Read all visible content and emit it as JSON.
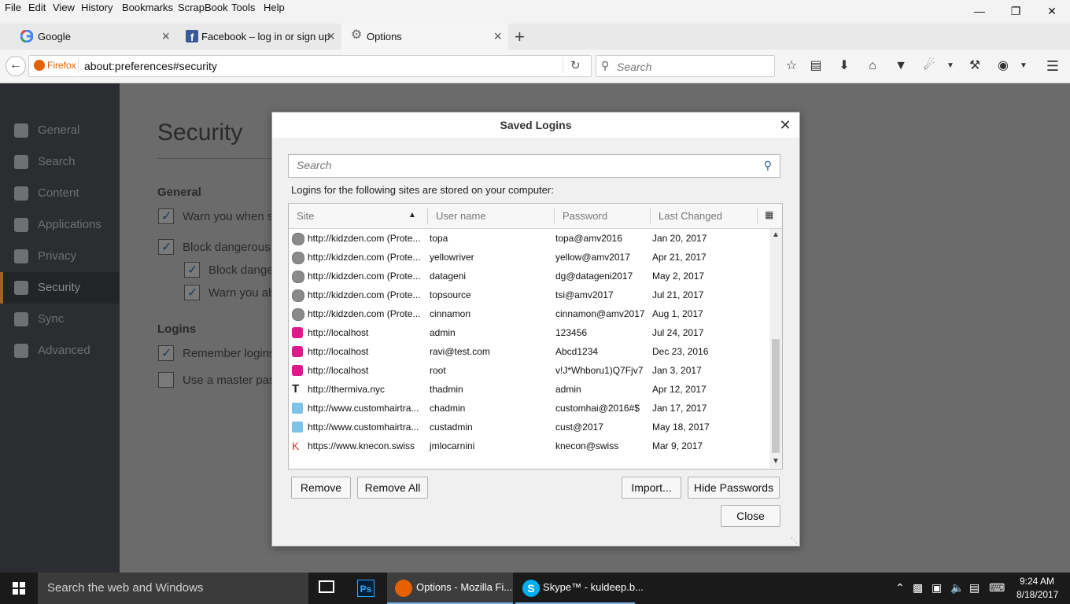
{
  "menubar": {
    "items": [
      "File",
      "Edit",
      "View",
      "History",
      "Bookmarks",
      "ScrapBook",
      "Tools",
      "Help"
    ]
  },
  "tabs": [
    {
      "title": "Google",
      "icon": "google-icon"
    },
    {
      "title": "Facebook – log in or sign up",
      "icon": "facebook-icon"
    },
    {
      "title": "Options",
      "icon": "gear-icon"
    }
  ],
  "navbar": {
    "identity_label": "Firefox",
    "url": "about:preferences#security",
    "search_placeholder": "Search"
  },
  "prefs": {
    "sidebar": [
      "General",
      "Search",
      "Content",
      "Applications",
      "Privacy",
      "Security",
      "Sync",
      "Advanced"
    ],
    "selected": "Security",
    "page_title": "Security",
    "general_heading": "General",
    "opt_warn": "Warn you when s",
    "opt_block": "Block dangerous",
    "opt_block_sub": "Block dange",
    "opt_warn_sub": "Warn you ab",
    "logins_heading": "Logins",
    "opt_remember": "Remember logins",
    "opt_master": "Use a master pas"
  },
  "dialog": {
    "title": "Saved Logins",
    "search_placeholder": "Search",
    "description": "Logins for the following sites are stored on your computer:",
    "columns": {
      "site": "Site",
      "username": "User name",
      "password": "Password",
      "changed": "Last Changed"
    },
    "rows": [
      {
        "site": "http://kidzden.com (Prote...",
        "user": "topa",
        "pass": "topa@amv2016",
        "changed": "Jan 20, 2017",
        "fav": "globe"
      },
      {
        "site": "http://kidzden.com (Prote...",
        "user": "yellowriver",
        "pass": "yellow@amv2017",
        "changed": "Apr 21, 2017",
        "fav": "globe"
      },
      {
        "site": "http://kidzden.com (Prote...",
        "user": "datageni",
        "pass": "dg@datageni2017",
        "changed": "May 2, 2017",
        "fav": "globe"
      },
      {
        "site": "http://kidzden.com (Prote...",
        "user": "topsource",
        "pass": "tsi@amv2017",
        "changed": "Jul 21, 2017",
        "fav": "globe"
      },
      {
        "site": "http://kidzden.com (Prote...",
        "user": "cinnamon",
        "pass": "cinnamon@amv2017",
        "changed": "Aug 1, 2017",
        "fav": "globe"
      },
      {
        "site": "http://localhost",
        "user": "admin",
        "pass": "123456",
        "changed": "Jul 24, 2017",
        "fav": "pink"
      },
      {
        "site": "http://localhost",
        "user": "ravi@test.com",
        "pass": "Abcd1234",
        "changed": "Dec 23, 2016",
        "fav": "pink"
      },
      {
        "site": "http://localhost",
        "user": "root",
        "pass": "v!J*Whboru1)Q7Fjv7",
        "changed": "Jan 3, 2017",
        "fav": "pink"
      },
      {
        "site": "http://thermiva.nyc",
        "user": "thadmin",
        "pass": "admin",
        "changed": "Apr 12, 2017",
        "fav": "T"
      },
      {
        "site": "http://www.customhairtra...",
        "user": "chadmin",
        "pass": "customhai@2016#$",
        "changed": "Jan 17, 2017",
        "fav": "blue"
      },
      {
        "site": "http://www.customhairtra...",
        "user": "custadmin",
        "pass": "cust@2017",
        "changed": "May 18, 2017",
        "fav": "blue"
      },
      {
        "site": "https://www.knecon.swiss",
        "user": "jmlocarnini",
        "pass": "knecon@swiss",
        "changed": "Mar 9, 2017",
        "fav": "K"
      }
    ],
    "buttons": {
      "remove": "Remove",
      "remove_all": "Remove All",
      "import": "Import...",
      "hide": "Hide Passwords",
      "close": "Close"
    }
  },
  "taskbar": {
    "search_text": "Search the web and Windows",
    "apps": [
      {
        "label": "Options - Mozilla Fi..."
      },
      {
        "label": "Skype™ - kuldeep.b..."
      }
    ],
    "time": "9:24 AM",
    "date": "8/18/2017"
  }
}
